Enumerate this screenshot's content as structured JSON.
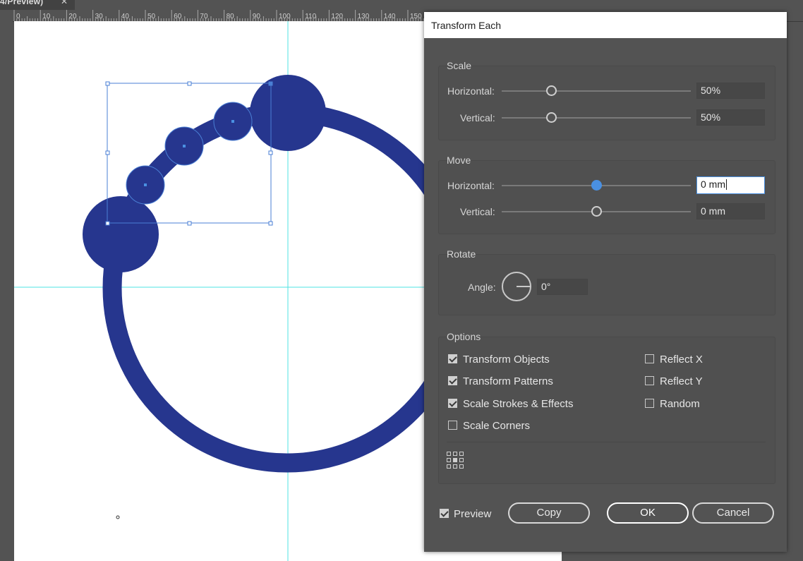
{
  "document": {
    "tab_title": "4/Preview)",
    "tab_close_icon": "close-icon"
  },
  "ruler": {
    "labels": [
      "0",
      "10",
      "20",
      "30",
      "40",
      "50",
      "60",
      "70",
      "80",
      "90",
      "100",
      "110",
      "120",
      "130",
      "140",
      "150"
    ]
  },
  "artwork": {
    "shape_color": "#26368e",
    "guide_color": "#4fe3e3",
    "selection_color": "#4a7fd4"
  },
  "dialog": {
    "title": "Transform Each",
    "scale": {
      "title": "Scale",
      "horizontal_label": "Horizontal:",
      "horizontal_value": "50%",
      "horizontal_level": 0.26,
      "vertical_label": "Vertical:",
      "vertical_value": "50%",
      "vertical_level": 0.26
    },
    "move": {
      "title": "Move",
      "horizontal_label": "Horizontal:",
      "horizontal_value": "0 mm",
      "horizontal_level": 0.5,
      "vertical_label": "Vertical:",
      "vertical_value": "0 mm",
      "vertical_level": 0.5
    },
    "rotate": {
      "title": "Rotate",
      "angle_label": "Angle:",
      "angle_value": "0°"
    },
    "options": {
      "title": "Options",
      "checkboxes": [
        {
          "label": "Transform Objects",
          "checked": true
        },
        {
          "label": "Transform Patterns",
          "checked": true
        },
        {
          "label": "Scale Strokes & Effects",
          "checked": true
        },
        {
          "label": "Scale Corners",
          "checked": false
        },
        {
          "label": "Reflect X",
          "checked": false
        },
        {
          "label": "Reflect Y",
          "checked": false
        },
        {
          "label": "Random",
          "checked": false
        }
      ],
      "reference_point_icon": "reference-point-locator-icon"
    },
    "preview_label": "Preview",
    "preview_checked": true,
    "copy_label": "Copy",
    "ok_label": "OK",
    "cancel_label": "Cancel",
    "accent_color": "#4a90e2"
  }
}
